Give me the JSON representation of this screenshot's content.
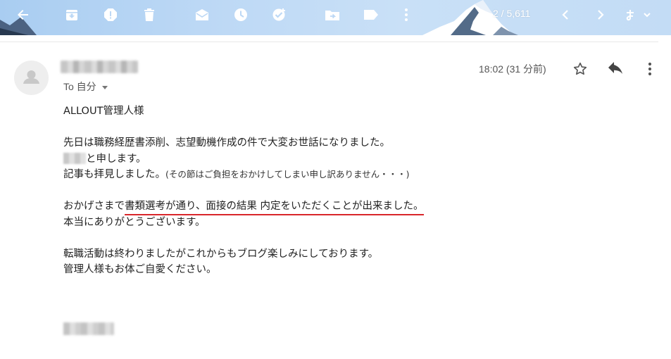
{
  "toolbar": {
    "counter": "2 / 5,611",
    "icons": [
      "back-arrow-icon",
      "archive-icon",
      "report-spam-icon",
      "delete-icon",
      "mark-unread-icon",
      "snooze-icon",
      "add-to-tasks-icon",
      "move-to-icon",
      "label-icon",
      "more-icon",
      "prev-icon",
      "next-icon",
      "input-tools-icon"
    ]
  },
  "header": {
    "to_label": "To 自分",
    "time": "18:02 (31 分前)"
  },
  "body": {
    "greeting": "ALLOUT管理人様",
    "line1": "先日は職務経歴書添削、志望動機作成の件で大変お世話になりました。",
    "line2_suffix": "と申します。",
    "line3_main": "記事も拝見しました。",
    "line3_small": "(その節はご負担をおかけしてしまい申し訳ありません・・・)",
    "line4_prefix": "おかげさまで",
    "line4_highlight": "書類選考が通り、面接の結果 内定をいただくことが出来ました。",
    "line5": "本当にありがとうございます。",
    "line6": "転職活動は終わりましたがこれからもブログ楽しみにしております。",
    "line7": "管理人様もお体ご自愛ください。"
  },
  "colors": {
    "highlight_underline": "#d9262b",
    "toolbar_bg": "#bcd8f5"
  }
}
